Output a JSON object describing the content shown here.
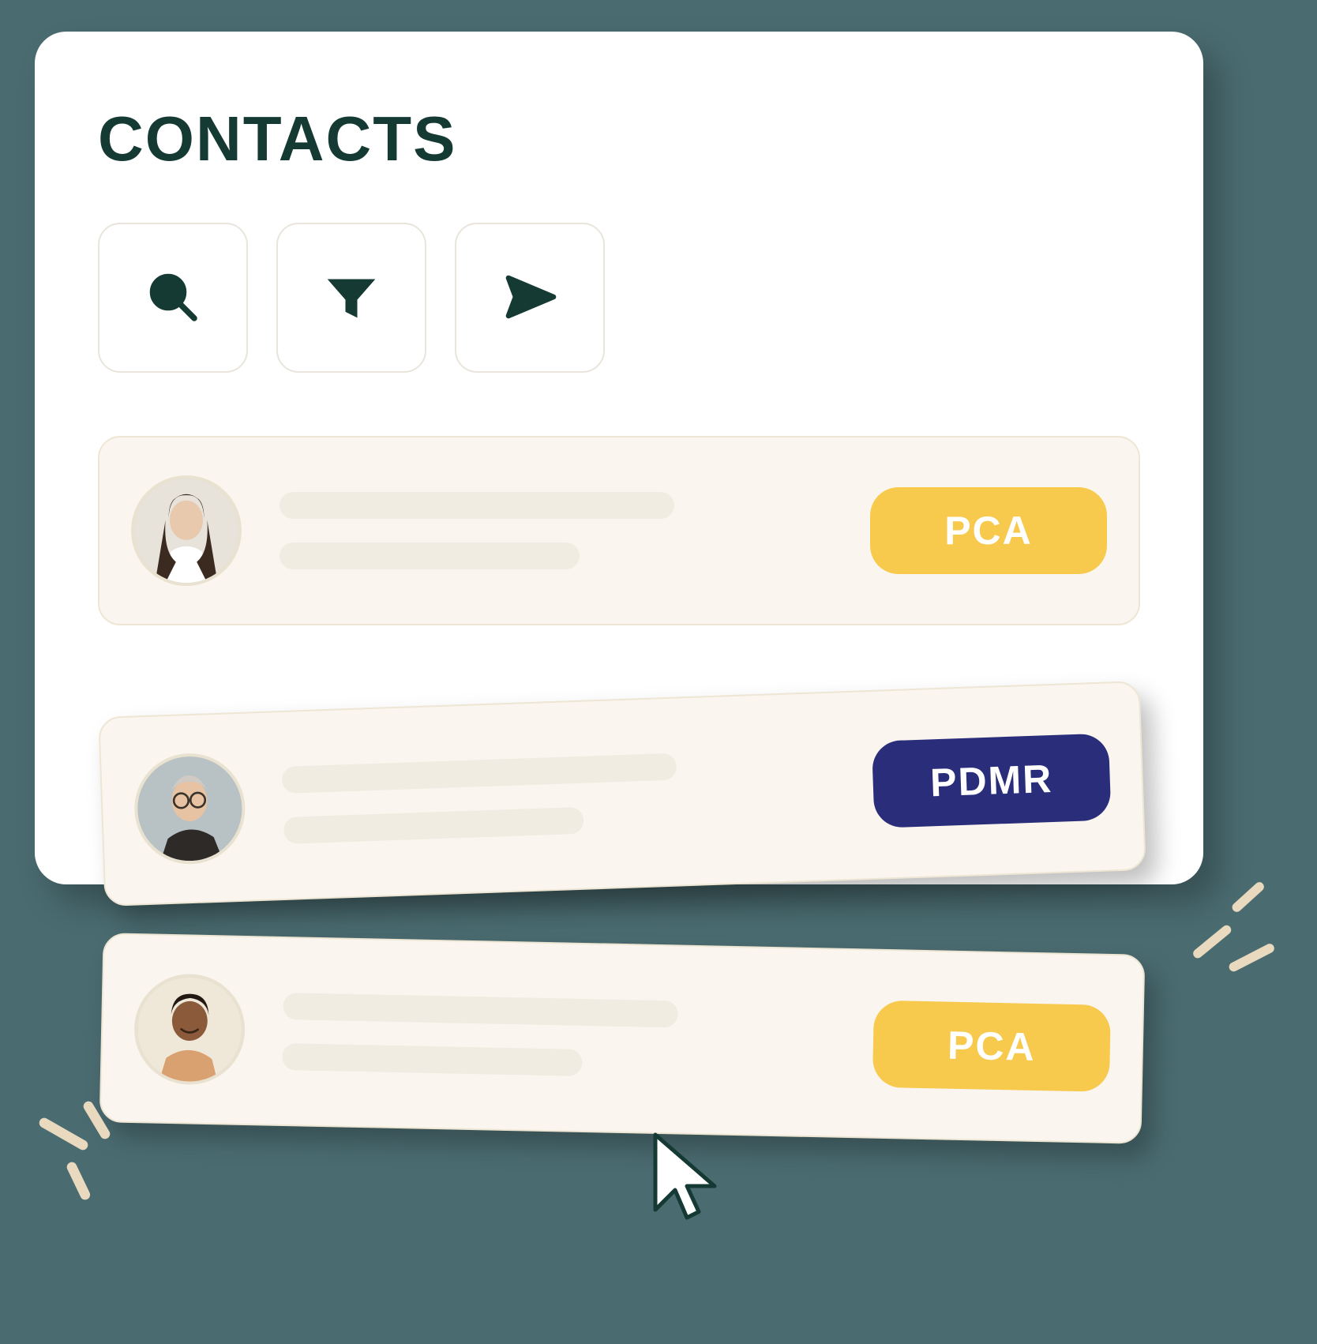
{
  "header": {
    "title": "CONTACTS"
  },
  "toolbar": {
    "search_icon": "search",
    "filter_icon": "filter",
    "send_icon": "send"
  },
  "contacts": [
    {
      "badge": "PCA",
      "badge_type": "pca"
    },
    {
      "badge": "PDMR",
      "badge_type": "pdmr"
    },
    {
      "badge": "PCA",
      "badge_type": "pca"
    }
  ]
}
